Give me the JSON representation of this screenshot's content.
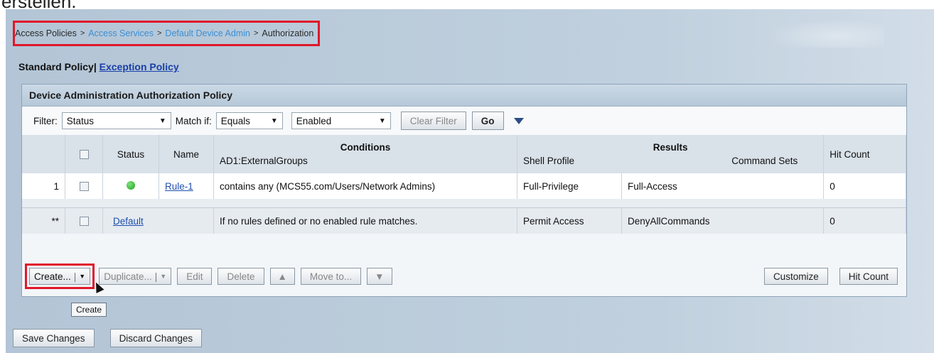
{
  "caption": "erstellen.",
  "breadcrumb": {
    "items": [
      "Access Policies",
      "Access Services",
      "Default Device Admin",
      "Authorization"
    ],
    "separator": ">"
  },
  "policy_tabs": {
    "standard": "Standard Policy",
    "divider": "|",
    "exception": "Exception Policy"
  },
  "policy_title": "Device Administration Authorization Policy",
  "filter": {
    "label": "Filter:",
    "field_value": "Status",
    "match_label": "Match if:",
    "operator_value": "Equals",
    "value_value": "Enabled",
    "clear_label": "Clear Filter",
    "go_label": "Go"
  },
  "table": {
    "headers": {
      "status": "Status",
      "name": "Name",
      "conditions": "Conditions",
      "conditions_sub": "AD1:ExternalGroups",
      "results": "Results",
      "shell_profile": "Shell Profile",
      "command_sets": "Command Sets",
      "hit_count": "Hit Count"
    },
    "rows": [
      {
        "num": "1",
        "name": "Rule-1",
        "condition": "contains any (MCS55.com/Users/Network Admins)",
        "shell_profile": "Full-Privilege",
        "command_sets": "Full-Access",
        "hit_count": "0"
      }
    ],
    "default_row": {
      "num": "**",
      "name": "Default",
      "condition": "If no rules defined or no enabled rule matches.",
      "shell_profile": "Permit Access",
      "command_sets": "DenyAllCommands",
      "hit_count": "0"
    }
  },
  "toolbar": {
    "create": "Create...",
    "duplicate": "Duplicate...",
    "edit": "Edit",
    "delete": "Delete",
    "move_to": "Move to...",
    "customize": "Customize",
    "hit_count": "Hit Count"
  },
  "tooltip": "Create",
  "footer": {
    "save": "Save Changes",
    "discard": "Discard Changes"
  },
  "colors": {
    "highlight": "#e0182a",
    "link": "#1e4fae",
    "breadcrumb_link": "#3a8fd6",
    "status_ok": "#1fa31f"
  }
}
